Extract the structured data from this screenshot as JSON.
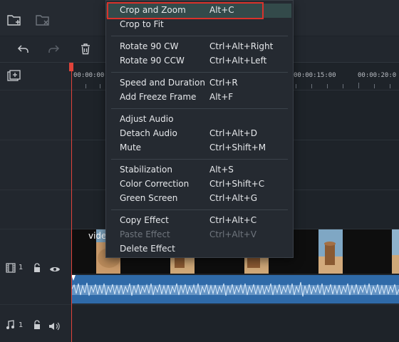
{
  "ruler": {
    "timecodes": [
      "00:00:00:",
      "00:00:15:00",
      "00:00:20:0"
    ]
  },
  "tracks": {
    "video": {
      "number": "1",
      "clip_label": "vide"
    },
    "audio": {
      "number": "1"
    }
  },
  "context_menu": {
    "groups": [
      [
        {
          "label": "Crop and Zoom",
          "shortcut": "Alt+C",
          "enabled": true,
          "highlighted": true
        },
        {
          "label": "Crop to Fit",
          "shortcut": "",
          "enabled": true
        }
      ],
      [
        {
          "label": "Rotate 90 CW",
          "shortcut": "Ctrl+Alt+Right",
          "enabled": true
        },
        {
          "label": "Rotate 90 CCW",
          "shortcut": "Ctrl+Alt+Left",
          "enabled": true
        }
      ],
      [
        {
          "label": "Speed and Duration",
          "shortcut": "Ctrl+R",
          "enabled": true
        },
        {
          "label": "Add Freeze Frame",
          "shortcut": "Alt+F",
          "enabled": true
        }
      ],
      [
        {
          "label": "Adjust Audio",
          "shortcut": "",
          "enabled": true
        },
        {
          "label": "Detach Audio",
          "shortcut": "Ctrl+Alt+D",
          "enabled": true
        },
        {
          "label": "Mute",
          "shortcut": "Ctrl+Shift+M",
          "enabled": true
        }
      ],
      [
        {
          "label": "Stabilization",
          "shortcut": "Alt+S",
          "enabled": true
        },
        {
          "label": "Color Correction",
          "shortcut": "Ctrl+Shift+C",
          "enabled": true
        },
        {
          "label": "Green Screen",
          "shortcut": "Ctrl+Alt+G",
          "enabled": true
        }
      ],
      [
        {
          "label": "Copy Effect",
          "shortcut": "Ctrl+Alt+C",
          "enabled": true
        },
        {
          "label": "Paste Effect",
          "shortcut": "Ctrl+Alt+V",
          "enabled": false
        },
        {
          "label": "Delete Effect",
          "shortcut": "",
          "enabled": true
        }
      ]
    ]
  },
  "icons": {
    "top": [
      "add-folder-icon",
      "remove-folder-icon"
    ],
    "toolbar": [
      "undo-icon",
      "redo-icon",
      "trash-icon"
    ],
    "ruler": "add-track-icon",
    "video_track": [
      "film-icon",
      "lock-icon",
      "eye-icon"
    ],
    "audio_track": [
      "music-note-icon",
      "lock-icon",
      "speaker-icon"
    ]
  },
  "colors": {
    "playhead": "#e0433a",
    "highlight_outline": "#d9322b",
    "audio_track": "#2f6aa8"
  }
}
